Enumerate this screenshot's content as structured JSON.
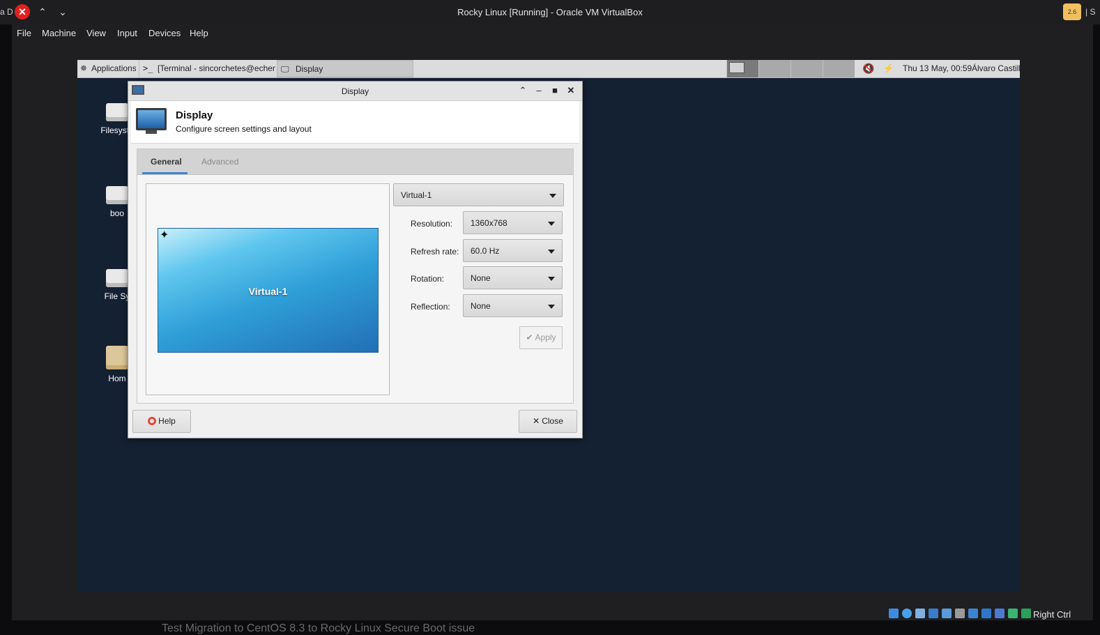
{
  "host": {
    "window_title": "Rocky Linux [Running] - Oracle VM VirtualBox",
    "left_clip": "a D",
    "right_clip": "| S",
    "badge": "2.6"
  },
  "vb_menu": [
    "File",
    "Machine",
    "View",
    "Input",
    "Devices",
    "Help"
  ],
  "panel": {
    "applications": "Applications",
    "tasks": [
      "[Terminal - sincorchetes@echem...",
      "Display"
    ],
    "clock": "Thu 13 May, 00:59",
    "user": "Álvaro Castillo"
  },
  "desktop_icons": [
    "Filesyste",
    "boo",
    "File Sy",
    "Hom"
  ],
  "dialog": {
    "window_title": "Display",
    "header_title": "Display",
    "header_subtitle": "Configure screen settings and layout",
    "tabs": [
      "General",
      "Advanced"
    ],
    "active_tab": "General",
    "preview_label": "Virtual-1",
    "output": "Virtual-1",
    "fields": {
      "resolution": {
        "label": "Resolution:",
        "value": "1360x768"
      },
      "refresh_rate": {
        "label": "Refresh rate:",
        "value": "60.0 Hz"
      },
      "rotation": {
        "label": "Rotation:",
        "value": "None"
      },
      "reflection": {
        "label": "Reflection:",
        "value": "None"
      }
    },
    "apply_label": "Apply",
    "help_label": "Help",
    "close_label": "Close"
  },
  "statusbar": {
    "host_key": "Right Ctrl"
  },
  "under_text": "Test Migration to CentOS 8.3 to Rocky Linux Secure Boot issue",
  "colors": {
    "guest_bg": "#142133",
    "accent": "#3d86d4",
    "close_red": "#e02020"
  }
}
